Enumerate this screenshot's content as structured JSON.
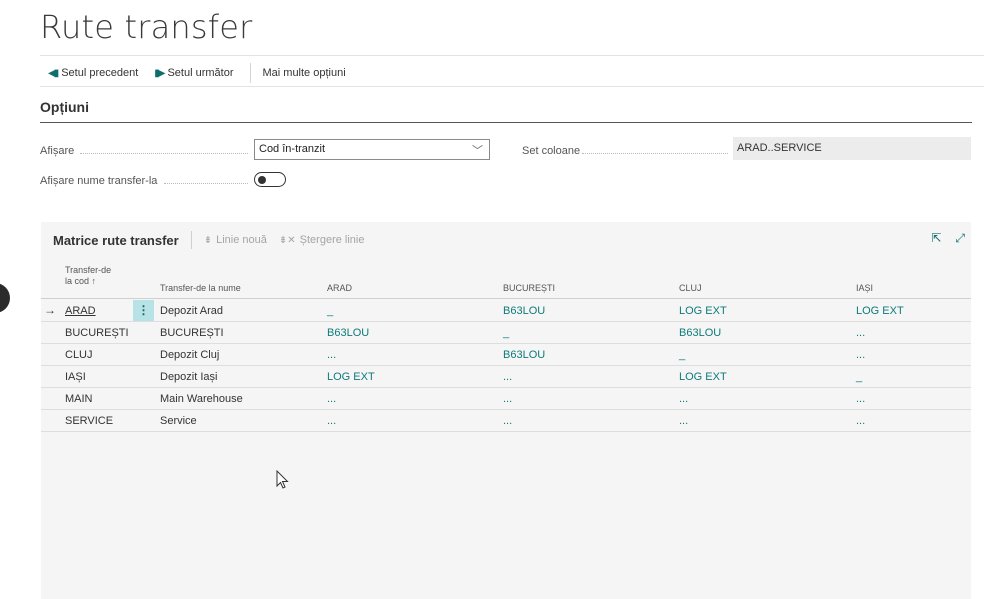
{
  "page": {
    "title": "Rute transfer"
  },
  "actions": {
    "previous": "Setul precedent",
    "next": "Setul următor",
    "more": "Mai multe opțiuni"
  },
  "options": {
    "section_title": "Opțiuni",
    "display_label": "Afișare",
    "display_value": "Cod în-tranzit",
    "column_set_label": "Set coloane",
    "column_set_value": "ARAD..SERVICE",
    "show_name_label": "Afișare nume transfer-la",
    "show_name_on": false
  },
  "matrix": {
    "title": "Matrice rute transfer",
    "new_line": "Linie nouă",
    "delete_line": "Ștergere linie",
    "headers": {
      "code_line1": "Transfer-de",
      "code_line2": "la cod ↑",
      "name": "Transfer-de la nume",
      "c1": "ARAD",
      "c2": "BUCUREȘTI",
      "c3": "CLUJ",
      "c4": "IAȘI"
    },
    "rows": [
      {
        "code": "ARAD",
        "name": "Depozit Arad",
        "c1": "_",
        "c2": "B63LOU",
        "c3": "LOG EXT",
        "c4": "LOG EXT"
      },
      {
        "code": "BUCUREȘTI",
        "name": "BUCUREȘTI",
        "c1": "B63LOU",
        "c2": "_",
        "c3": "B63LOU",
        "c4": "..."
      },
      {
        "code": "CLUJ",
        "name": "Depozit Cluj",
        "c1": "...",
        "c2": "B63LOU",
        "c3": "_",
        "c4": "..."
      },
      {
        "code": "IAȘI",
        "name": "Depozit Iași",
        "c1": "LOG EXT",
        "c2": "...",
        "c3": "LOG EXT",
        "c4": "_"
      },
      {
        "code": "MAIN",
        "name": "Main Warehouse",
        "c1": "...",
        "c2": "...",
        "c3": "...",
        "c4": "..."
      },
      {
        "code": "SERVICE",
        "name": "Service",
        "c1": "...",
        "c2": "...",
        "c3": "...",
        "c4": "..."
      }
    ]
  },
  "colors": {
    "accent": "#0e7a7a",
    "selected_cell": "#b8e3e6",
    "panel_bg": "#f5f5f5"
  },
  "icons": [
    "previous-set-icon",
    "next-set-icon",
    "chevron-down-icon",
    "new-line-icon",
    "delete-line-icon",
    "share-icon",
    "expand-icon",
    "row-arrow-icon",
    "mouse-cursor-icon"
  ]
}
